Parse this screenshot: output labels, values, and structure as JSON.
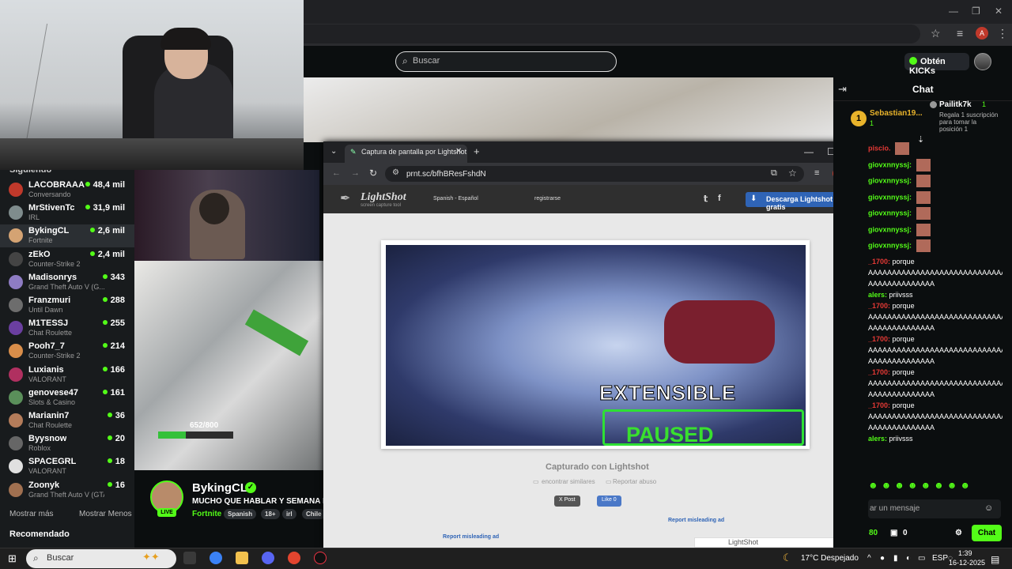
{
  "kick": {
    "search_placeholder": "Buscar",
    "kicks_button": "Obtén KICKs"
  },
  "sidebar": {
    "section_title": "Siguiendo",
    "channels": [
      {
        "name": "LACOBRAAA",
        "category": "Conversando",
        "viewers": "48,4 mil"
      },
      {
        "name": "MrStivenTc",
        "category": "IRL",
        "viewers": "31,9 mil"
      },
      {
        "name": "BykingCL",
        "category": "Fortnite",
        "viewers": "2,6 mil"
      },
      {
        "name": "zEkO",
        "category": "Counter-Strike 2",
        "viewers": "2,4 mil"
      },
      {
        "name": "Madisonrys",
        "category": "Grand Theft Auto V (G...",
        "viewers": "343"
      },
      {
        "name": "Franzmuri",
        "category": "Until Dawn",
        "viewers": "288"
      },
      {
        "name": "M1TESSJ",
        "category": "Chat Roulette",
        "viewers": "255"
      },
      {
        "name": "Pooh7_7",
        "category": "Counter-Strike 2",
        "viewers": "214"
      },
      {
        "name": "Luxianis",
        "category": "VALORANT",
        "viewers": "166"
      },
      {
        "name": "genovese47",
        "category": "Slots & Casino",
        "viewers": "161"
      },
      {
        "name": "Marianin7",
        "category": "Chat Roulette",
        "viewers": "36"
      },
      {
        "name": "Byysnow",
        "category": "Roblox",
        "viewers": "20"
      },
      {
        "name": "SPACEGRL",
        "category": "VALORANT",
        "viewers": "18"
      },
      {
        "name": "Zoonyk",
        "category": "Grand Theft Auto V (GTA)",
        "viewers": "16"
      }
    ],
    "show_more": "Mostrar más",
    "show_less": "Mostrar Menos",
    "recommended": "Recomendado"
  },
  "stream": {
    "hp": "652/800",
    "hp_fraction": 0.37,
    "streamer": "BykingCL",
    "live": "LIVE",
    "title": "MUCHO QUE HABLAR Y SEMANA INC",
    "category": "Fortnite",
    "tags": [
      "Spanish",
      "18+",
      "irl",
      "Chile"
    ]
  },
  "lightshot": {
    "tab_title": "Captura de pantalla por Lightshot",
    "url": "prnt.sc/bfhBResFshdN",
    "logo": "LightShot",
    "logo_sub": "screen capture tool",
    "language": "Spanish - Español",
    "register": "registrarse",
    "download": "Descarga Lightshot gratis",
    "overlay_top": "EXTENSIBLE",
    "overlay_bottom": "PAUSED",
    "captured": "Capturado con Lightshot",
    "similar": "encontrar similares",
    "report_abuse": "Reportar abuso",
    "post": "X Post",
    "like": "Like 0",
    "report_ad_1": "Report misleading ad",
    "report_ad_2": "Report misleading ad",
    "ad_brand": "LightShot"
  },
  "chat": {
    "title": "Chat",
    "sub_rank": "1",
    "sub_name": "Sebastian19...",
    "sub_count": "1",
    "gifter_name": "Pailitk7k",
    "gifter_count": "1",
    "gifter_note": "Regala 1 suscripción para tomar la posición 1",
    "messages": [
      {
        "user": "piscio.",
        "text": "",
        "emote": true,
        "red": true
      },
      {
        "user": "giovxnnyssj:",
        "text": "",
        "emote": true
      },
      {
        "user": "giovxnnyssj:",
        "text": "",
        "emote": true
      },
      {
        "user": "giovxnnyssj:",
        "text": "",
        "emote": true
      },
      {
        "user": "giovxnnyssj:",
        "text": "",
        "emote": true
      },
      {
        "user": "giovxnnyssj:",
        "text": "",
        "emote": true
      },
      {
        "user": "giovxnnyssj:",
        "text": "",
        "emote": true
      },
      {
        "user": "_1700:",
        "text": "porque",
        "red": true
      },
      {
        "user": "",
        "text": "AAAAAAAAAAAAAAAAAAAAAAAAAAAAA"
      },
      {
        "user": "",
        "text": "AAAAAAAAAAAAAA"
      },
      {
        "user": "alers:",
        "text": "priivsss"
      },
      {
        "user": "_1700:",
        "text": "porque",
        "red": true
      },
      {
        "user": "",
        "text": "AAAAAAAAAAAAAAAAAAAAAAAAAAAAA"
      },
      {
        "user": "",
        "text": "AAAAAAAAAAAAAA"
      },
      {
        "user": "_1700:",
        "text": "porque",
        "red": true
      },
      {
        "user": "",
        "text": "AAAAAAAAAAAAAAAAAAAAAAAAAAAAA"
      },
      {
        "user": "",
        "text": "AAAAAAAAAAAAAA"
      },
      {
        "user": "_1700:",
        "text": "porque",
        "red": true
      },
      {
        "user": "",
        "text": "AAAAAAAAAAAAAAAAAAAAAAAAAAAAA"
      },
      {
        "user": "",
        "text": "AAAAAAAAAAAAAA"
      },
      {
        "user": "_1700:",
        "text": "porque",
        "red": true
      },
      {
        "user": "",
        "text": "AAAAAAAAAAAAAAAAAAAAAAAAAAAAA"
      },
      {
        "user": "",
        "text": "AAAAAAAAAAAAAA"
      },
      {
        "user": "alers:",
        "text": "priivsss"
      }
    ],
    "input_placeholder": "ar un mensaje",
    "points": "80",
    "gifts": "0",
    "send": "Chat"
  },
  "taskbar": {
    "search": "Buscar",
    "weather": "17°C  Despejado",
    "lang": "ESP",
    "time": "1:39",
    "date": "16-12-2025"
  },
  "colors": {
    "kick_green": "#53fc18",
    "chrome_dark": "#202124"
  }
}
